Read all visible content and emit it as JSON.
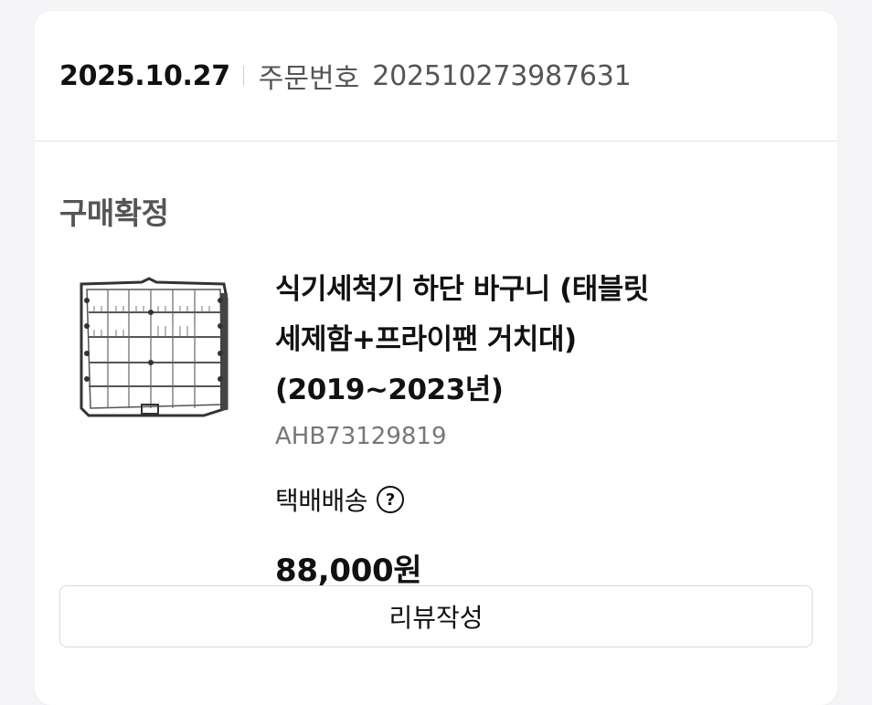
{
  "order": {
    "date": "2025.10.27",
    "number_label": "주문번호",
    "number": "202510273987631"
  },
  "status": "구매확정",
  "product": {
    "image_icon": "dishwasher-basket-image",
    "title_lines": [
      "식기세척기 하단 바구니 (태블릿",
      "세제함+프라이팬 거치대)",
      "(2019~2023년)"
    ],
    "code": "AHB73129819",
    "shipping_label": "택배배송",
    "help_icon": "question-circle-icon",
    "help_glyph": "?",
    "price": "88,000원"
  },
  "actions": {
    "review_label": "리뷰작성"
  },
  "colors": {
    "background": "#f5f5f7",
    "card": "#ffffff",
    "text_primary": "#111111",
    "text_secondary": "#555555",
    "text_muted": "#777777",
    "border": "#d9d9d9"
  }
}
